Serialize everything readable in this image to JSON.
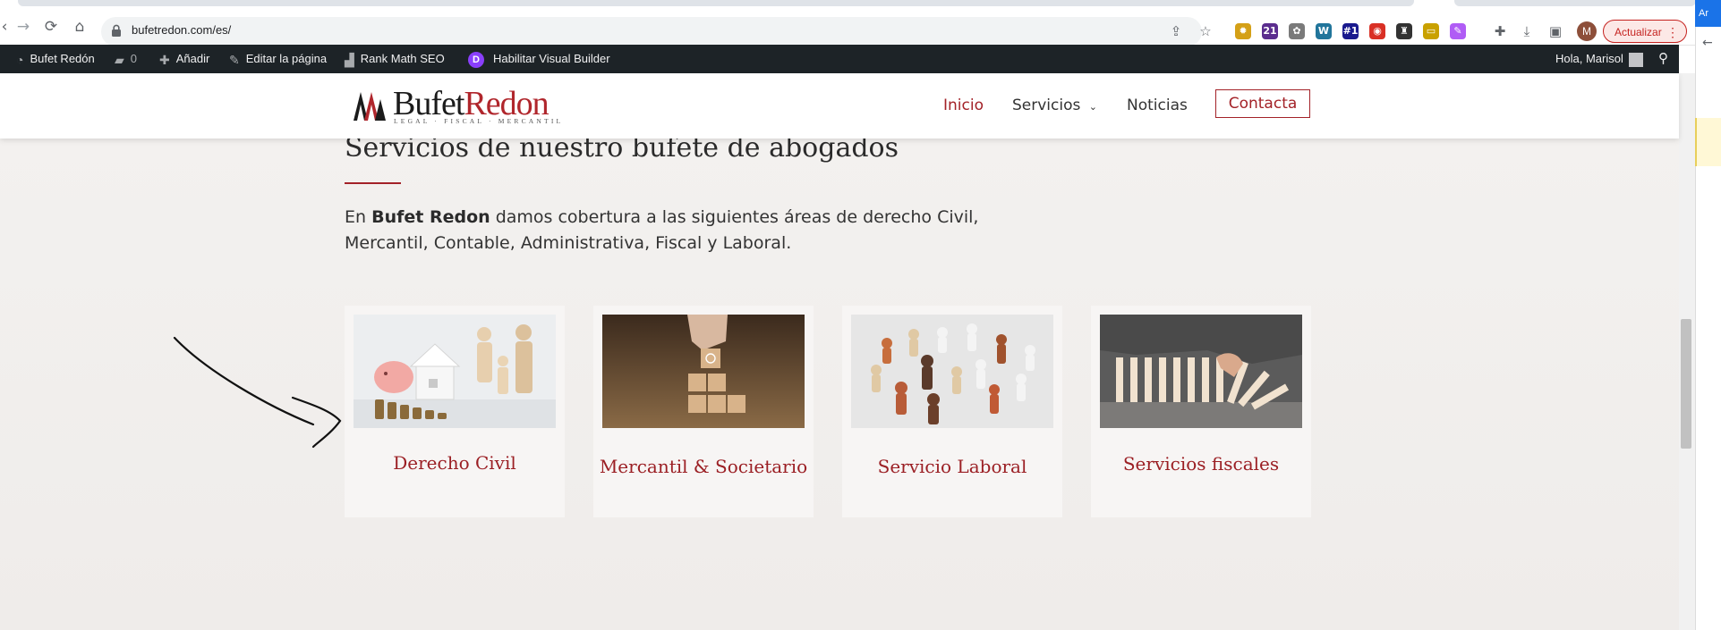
{
  "browser": {
    "url": "bufetredon.com/es/",
    "update_label": "Actualizar",
    "avatar_letter": "M",
    "side_panel_tab": "Ar",
    "extensions": [
      {
        "name": "gear-extension-icon",
        "label": "✹",
        "color": "#d4a017"
      },
      {
        "name": "graduation-extension-icon",
        "label": "21",
        "color": "#5b2d8e"
      },
      {
        "name": "flower-extension-icon",
        "label": "✿",
        "color": "#7a7a7a"
      },
      {
        "name": "wordpress-extension-icon",
        "label": "W",
        "color": "#21759b"
      },
      {
        "name": "rank-extension-icon",
        "label": "#1",
        "color": "#1a1a8e"
      },
      {
        "name": "pin-extension-icon",
        "label": "◉",
        "color": "#d93025"
      },
      {
        "name": "hat-extension-icon",
        "label": "♜",
        "color": "#333333"
      },
      {
        "name": "folder-extension-icon",
        "label": "▭",
        "color": "#c9a100"
      },
      {
        "name": "brush-extension-icon",
        "label": "✎",
        "color": "#b05cf5"
      }
    ]
  },
  "wpbar": {
    "site_name": "Bufet Redón",
    "comments_count": "0",
    "add_label": "Añadir",
    "edit_label": "Editar la página",
    "seo_label": "Rank Math SEO",
    "builder_label": "Habilitar Visual Builder",
    "greeting": "Hola, Marisol"
  },
  "header": {
    "logo_word1": "Bufet",
    "logo_word2": "Redon",
    "logo_tagline": "LEGAL · FISCAL · MERCANTIL",
    "menu": {
      "inicio": "Inicio",
      "servicios": "Servicios",
      "noticias": "Noticias",
      "contacta": "Contacta"
    }
  },
  "main": {
    "title": "Servicios de nuestro bufete de abogados",
    "intro_before": "En ",
    "intro_bold": "Bufet Redon",
    "intro_after": " damos cobertura a las siguientes áreas de derecho Civil, Mercantil, Contable, Administrativa, Fiscal y Laboral.",
    "cards": [
      {
        "title": "Derecho Civil"
      },
      {
        "title": "Mercantil & Societario"
      },
      {
        "title": "Servicio Laboral"
      },
      {
        "title": "Servicios fiscales"
      }
    ]
  },
  "colors": {
    "brand_red": "#a32228",
    "admin_bar": "#1d2327"
  }
}
